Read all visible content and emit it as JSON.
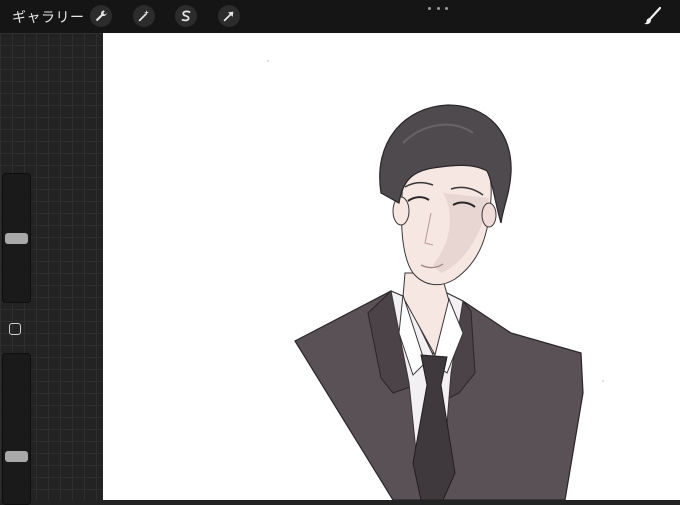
{
  "toolbar": {
    "gallery_label": "ギャラリー",
    "tools": [
      {
        "name": "actions",
        "icon": "wrench-icon"
      },
      {
        "name": "adjustments",
        "icon": "magic-wand-icon"
      },
      {
        "name": "selection",
        "icon": "selection-s-icon"
      },
      {
        "name": "transform",
        "icon": "arrow-cursor-icon"
      }
    ],
    "more_icon": "ellipsis-icon",
    "brush_icon": "brush-icon"
  },
  "sidebar": {
    "brush_size": 0.5,
    "opacity": 0.3,
    "modify_icon": "square-icon"
  },
  "canvas": {
    "content": "illustration-man-in-suit"
  },
  "colors": {
    "toolbar_bg": "#151515",
    "sidebar_bg": "#232323",
    "canvas_bg": "#ffffff",
    "suit": "#5a5156",
    "hair": "#4e4a4e",
    "skin": "#f6e7e3"
  }
}
